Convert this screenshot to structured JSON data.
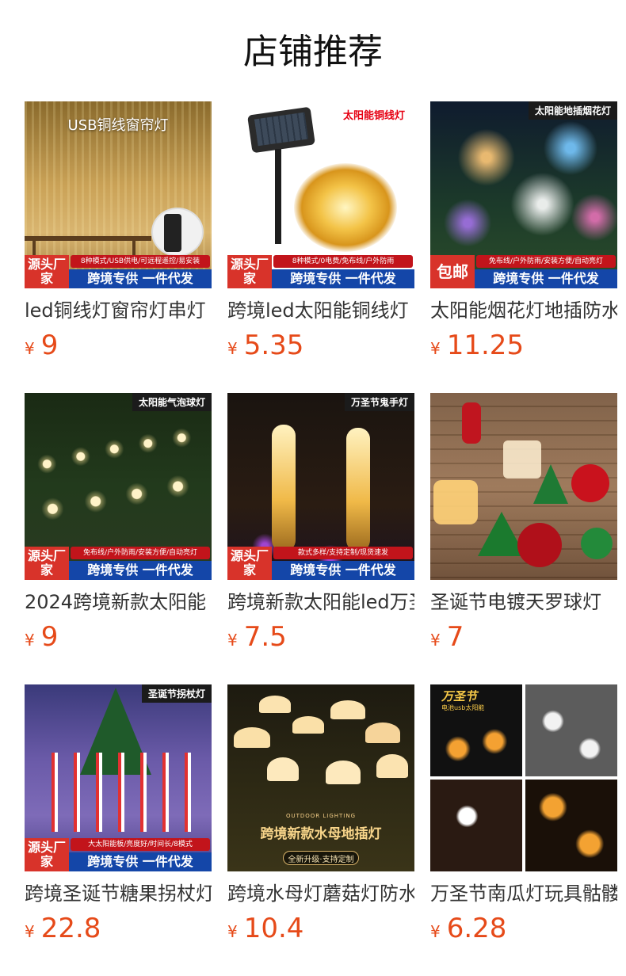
{
  "section": {
    "title": "店铺推荐"
  },
  "currency_symbol": "¥",
  "products": [
    {
      "name": "led铜线灯窗帘灯串灯",
      "price": "9",
      "image": {
        "big_title": "USB铜线窗帘灯",
        "source_tag": "源头厂家",
        "features": "8种模式/USB供电/可远程遥控/易安装",
        "slogan": "跨境专供 一件代发"
      }
    },
    {
      "name": "跨境led太阳能铜线灯",
      "price": "5.35",
      "image": {
        "top_label": "太阳能铜线灯",
        "source_tag": "源头厂家",
        "features": "8种模式/0电费/免布线/户外防雨",
        "slogan": "跨境专供 一件代发"
      }
    },
    {
      "name": "太阳能烟花灯地插防水",
      "price": "11.25",
      "image": {
        "top_label": "太阳能地插烟花灯",
        "source_tag": "包邮",
        "features": "免布线/户外防雨/安装方便/自动亮灯",
        "slogan": "跨境专供 一件代发"
      }
    },
    {
      "name": "2024跨境新款太阳能",
      "price": "9",
      "image": {
        "top_label": "太阳能气泡球灯",
        "source_tag": "源头厂家",
        "features": "免布线/户外防雨/安装方便/自动亮灯",
        "slogan": "跨境专供 一件代发"
      }
    },
    {
      "name": "跨境新款太阳能led万圣",
      "price": "7.5",
      "image": {
        "top_label": "万圣节鬼手灯",
        "source_tag": "源头厂家",
        "features": "款式多样/支持定制/现货速发",
        "slogan": "跨境专供 一件代发"
      }
    },
    {
      "name": "圣诞节电镀天罗球灯",
      "price": "7",
      "image": {}
    },
    {
      "name": "跨境圣诞节糖果拐杖灯",
      "price": "22.8",
      "image": {
        "top_label": "圣诞节拐杖灯",
        "source_tag": "源头厂家",
        "features": "大太阳能板/亮度好/时间长/8模式",
        "slogan": "跨境专供 一件代发"
      }
    },
    {
      "name": "跨境水母灯蘑菇灯防水",
      "price": "10.4",
      "image": {
        "caption_small": "OUTDOOR LIGHTING",
        "caption": "跨境新款水母地插灯",
        "caption_sub": "全新升级·支持定制"
      }
    },
    {
      "name": "万圣节南瓜灯玩具骷髅",
      "price": "6.28",
      "image": {
        "corner_title": "万圣节",
        "corner_sub": "电池usb太阳能"
      }
    }
  ]
}
